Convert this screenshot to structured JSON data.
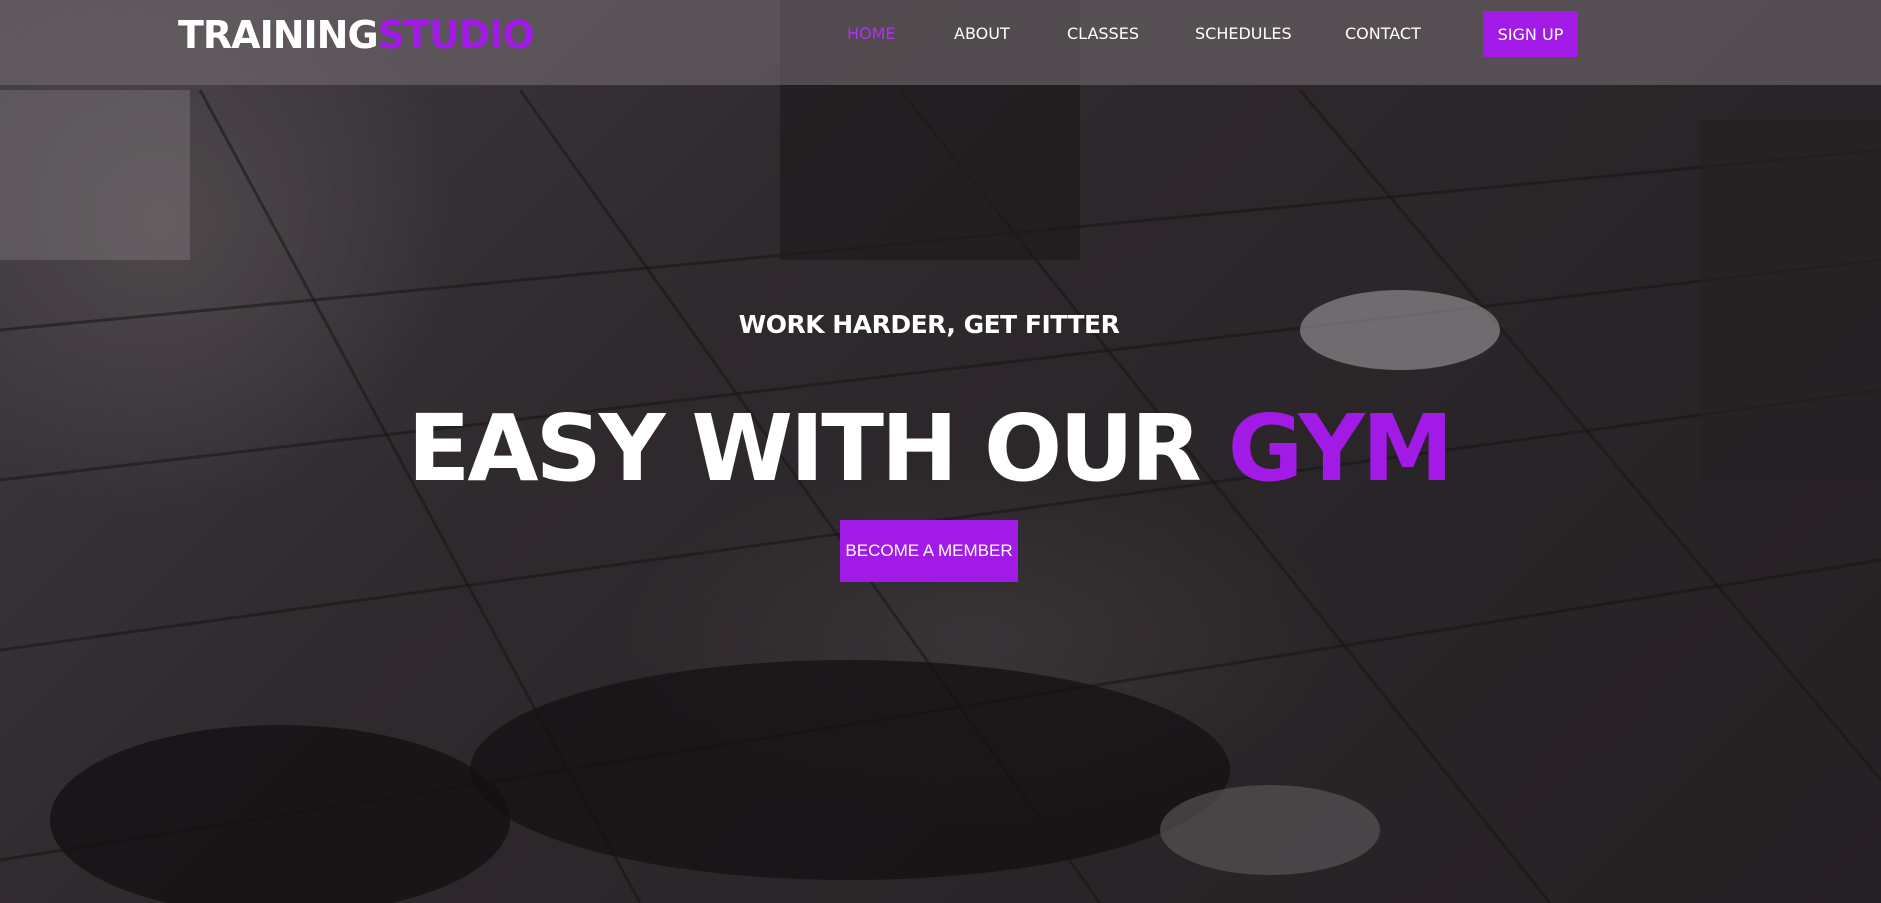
{
  "header": {
    "logo_main": "TRAINING",
    "logo_accent": "STUDIO",
    "nav": [
      {
        "label": "HOME",
        "active": true
      },
      {
        "label": "ABOUT",
        "active": false
      },
      {
        "label": "CLASSES",
        "active": false
      },
      {
        "label": "SCHEDULES",
        "active": false
      },
      {
        "label": "CONTACT",
        "active": false
      }
    ],
    "signup_label": "SIGN UP"
  },
  "hero": {
    "subtitle": "WORK HARDER, GET FITTER",
    "headline_main": "EASY WITH OUR",
    "headline_accent": "GYM",
    "cta_label": "BECOME A MEMBER"
  },
  "colors": {
    "accent": "#a21ae6",
    "nav_active": "#b430f0",
    "text": "#ffffff"
  }
}
